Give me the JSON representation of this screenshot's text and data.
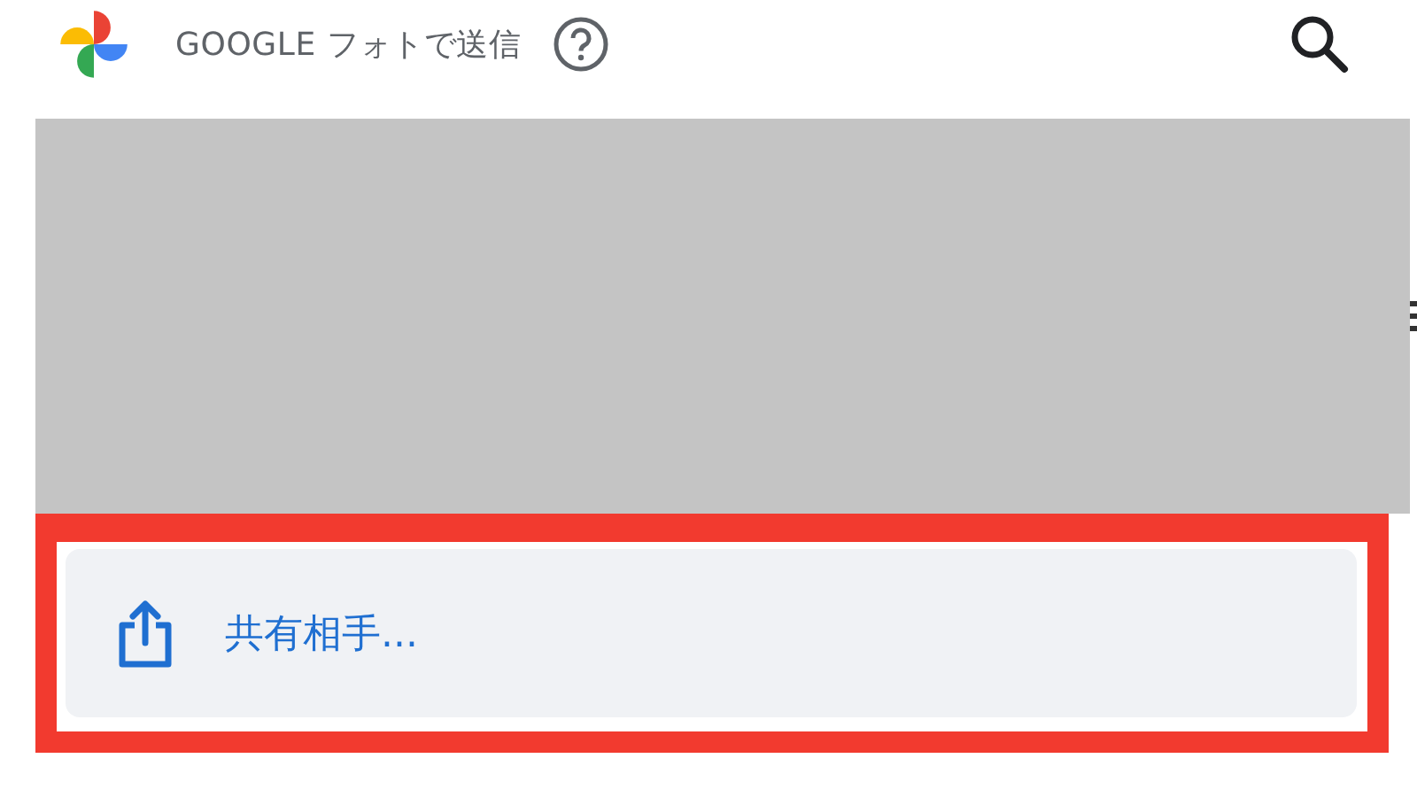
{
  "header": {
    "title": "GOOGLE フォトで送信"
  },
  "share_button": {
    "label": "共有相手..."
  }
}
